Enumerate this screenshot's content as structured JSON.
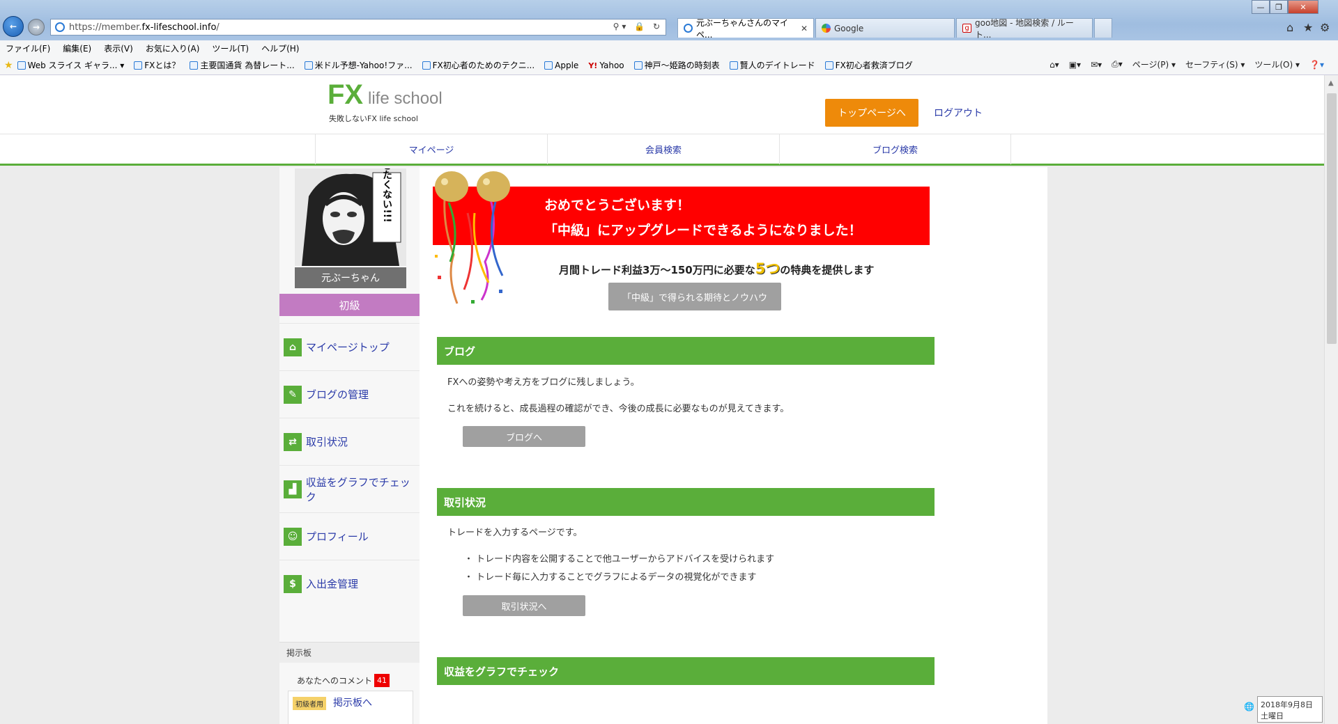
{
  "browser": {
    "url_prefix": "https://member.",
    "url_domain": "fx-lifeschool.info",
    "url_suffix": "/",
    "tabs": [
      {
        "label": "元ぶーちゃんさんのマイペ...",
        "active": true
      },
      {
        "label": "Google",
        "active": false
      },
      {
        "label": "goo地図 - 地図検索 / ルート...",
        "active": false
      }
    ],
    "menu": [
      "ファイル(F)",
      "編集(E)",
      "表示(V)",
      "お気に入り(A)",
      "ツール(T)",
      "ヘルプ(H)"
    ],
    "favorites": [
      "Web スライス ギャラ... ▾",
      "FXとは？",
      "主要国通貨 為替レート...",
      "米ドル予想-Yahoo!ファ...",
      "FX初心者のためのテクニ...",
      "Apple",
      "Yahoo",
      "神戸～姫路の時刻表",
      "賢人のデイトレード",
      "FX初心者救済ブログ"
    ],
    "commands": [
      "ページ(P) ▾",
      "セーフティ(S) ▾",
      "ツール(O) ▾"
    ]
  },
  "site": {
    "logo_main": "FX",
    "logo_sub": "life school",
    "tagline": "失敗しないFX life school",
    "top_button": "トップページへ",
    "logout": "ログアウト",
    "nav": [
      "マイページ",
      "会員検索",
      "ブログ検索"
    ]
  },
  "sidebar": {
    "avatar_caption": "働きたくない!!!",
    "user_name": "元ぶーちゃん",
    "rank": "初級",
    "menu": [
      {
        "label": "マイページトップ",
        "icon": "home-icon"
      },
      {
        "label": "ブログの管理",
        "icon": "blog-icon"
      },
      {
        "label": "取引状況",
        "icon": "trade-icon"
      },
      {
        "label": "収益をグラフでチェック",
        "icon": "chart-icon"
      },
      {
        "label": "プロフィール",
        "icon": "profile-icon"
      },
      {
        "label": "入出金管理",
        "icon": "dollar-icon"
      }
    ],
    "board_title": "掲示板",
    "comment_label": "あなたへのコメント",
    "comment_count": "41",
    "board_tag": "初級者用",
    "board_link": "掲示板へ"
  },
  "main": {
    "congrats_line1": "おめでとうございます！",
    "congrats_line2": "「中級」にアップグレードできるようになりました！",
    "privilege_pre": "月間トレード利益3万～150万円に必要な",
    "privilege_num": "5つ",
    "privilege_post": "の特典を提供します",
    "privilege_button": "「中級」で得られる期待とノウハウ",
    "sections": {
      "blog": {
        "title": "ブログ",
        "text1": "FXへの姿勢や考え方をブログに残しましょう。",
        "text2": "これを続けると、成長過程の確認ができ、今後の成長に必要なものが見えてきます。",
        "button": "ブログへ"
      },
      "trade": {
        "title": "取引状況",
        "text1": "トレードを入力するページです。",
        "bullet1": "・ トレード内容を公開することで他ユーザーからアドバイスを受けられます",
        "bullet2": "・ トレード毎に入力することでグラフによるデータの視覚化ができます",
        "button": "取引状況へ"
      },
      "graph": {
        "title": "収益をグラフでチェック"
      }
    }
  },
  "taskbar": {
    "date": "2018年9月8日",
    "weekday": "土曜日"
  },
  "colors": {
    "brand_green": "#5aae3a",
    "accent_orange": "#ee8a0a",
    "alert_red": "#ff0000",
    "rank_purple": "#c27bc2",
    "link_blue": "#2a3aa8"
  }
}
